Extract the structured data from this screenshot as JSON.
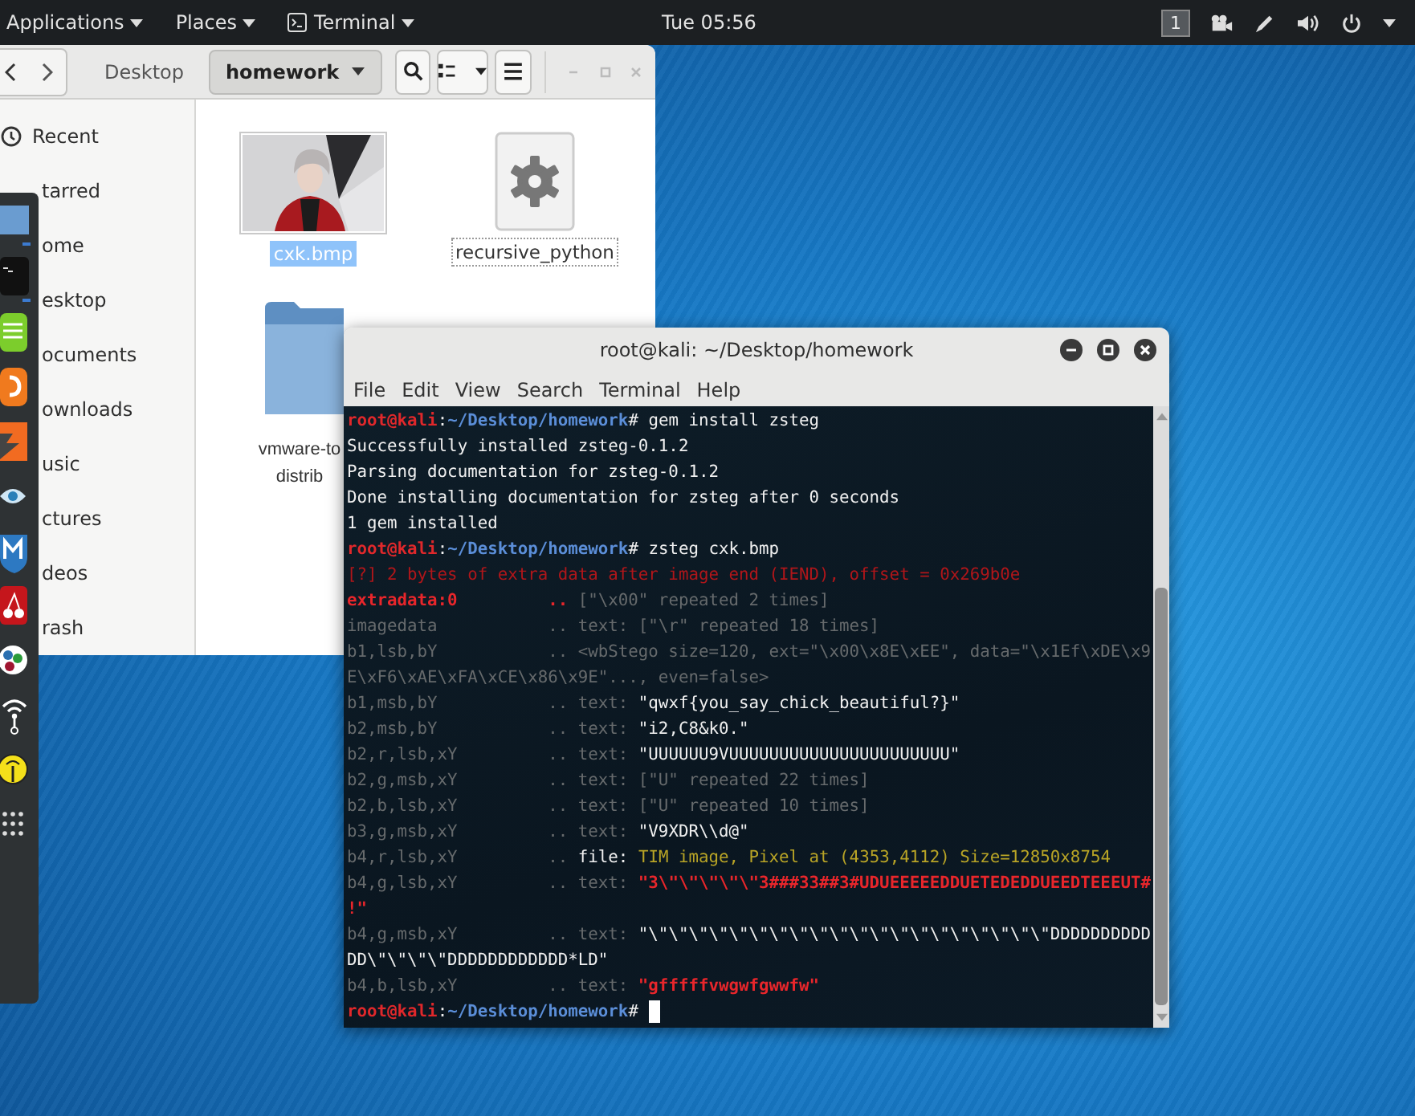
{
  "top_bar": {
    "menus": [
      {
        "label": "Applications"
      },
      {
        "label": "Places"
      },
      {
        "label": "Terminal"
      }
    ],
    "clock": "Tue 05:56",
    "workspace": "1"
  },
  "file_manager": {
    "path": [
      {
        "label": "Desktop",
        "selected": false
      },
      {
        "label": "homework",
        "selected": true
      }
    ],
    "sidebar": [
      "Recent",
      "tarred",
      "ome",
      "esktop",
      "ocuments",
      "ownloads",
      "usic",
      "ctures",
      "deos",
      "rash"
    ],
    "files": [
      {
        "label": "cxk.bmp",
        "selected": true
      },
      {
        "label": "recursive_python",
        "kind": "executable",
        "selected": false
      },
      {
        "label": "vmware-to distrib",
        "kind": "folder",
        "selected": false
      }
    ]
  },
  "terminal": {
    "title": "root@kali: ~/Desktop/homework",
    "menu": [
      "File",
      "Edit",
      "View",
      "Search",
      "Terminal",
      "Help"
    ],
    "lines": [
      {
        "segments": [
          {
            "t": "root@kali",
            "kind": "user"
          },
          {
            "t": ":",
            "kind": "plain"
          },
          {
            "t": "~/Desktop/homework",
            "kind": "path"
          },
          {
            "t": "# gem install zsteg",
            "kind": "plain"
          }
        ]
      },
      {
        "segments": [
          {
            "t": "Successfully installed zsteg-0.1.2",
            "kind": "plain"
          }
        ]
      },
      {
        "segments": [
          {
            "t": "Parsing documentation for zsteg-0.1.2",
            "kind": "plain"
          }
        ]
      },
      {
        "segments": [
          {
            "t": "Done installing documentation for zsteg after 0 seconds",
            "kind": "plain"
          }
        ]
      },
      {
        "segments": [
          {
            "t": "1 gem installed",
            "kind": "plain"
          }
        ]
      },
      {
        "segments": [
          {
            "t": "root@kali",
            "kind": "user"
          },
          {
            "t": ":",
            "kind": "plain"
          },
          {
            "t": "~/Desktop/homework",
            "kind": "path"
          },
          {
            "t": "# zsteg cxk.bmp",
            "kind": "plain"
          }
        ]
      },
      {
        "segments": [
          {
            "t": "[?] 2 bytes of extra data after image end (IEND), offset = 0x269b0e",
            "kind": "error"
          }
        ]
      },
      {
        "segments": [
          {
            "t": "extradata:0         .. ",
            "kind": "red"
          },
          {
            "t": "[\"\\x00\" repeated 2 times]",
            "kind": "dim"
          }
        ]
      },
      {
        "segments": [
          {
            "t": "imagedata           .. text: [\"\\r\" repeated 18 times]",
            "kind": "dim"
          }
        ]
      },
      {
        "segments": [
          {
            "t": "b1,lsb,bY           .. <wbStego size=120, ext=\"\\x00\\x8E\\xEE\", data=\"\\x1Ef\\xDE\\x9",
            "kind": "dim"
          }
        ]
      },
      {
        "segments": [
          {
            "t": "E\\xF6\\xAE\\xFA\\xCE\\x86\\x9E\"..., even=false>",
            "kind": "dim"
          }
        ]
      },
      {
        "segments": [
          {
            "t": "b1,msb,bY           .. text: ",
            "kind": "dim"
          },
          {
            "t": "\"qwxf{you_say_chick_beautiful?}\"",
            "kind": "plain"
          }
        ]
      },
      {
        "segments": [
          {
            "t": "b2,msb,bY           .. text: ",
            "kind": "dim"
          },
          {
            "t": "\"i2,C8&k0.\"",
            "kind": "plain"
          }
        ]
      },
      {
        "segments": [
          {
            "t": "b2,r,lsb,xY         .. text: ",
            "kind": "dim"
          },
          {
            "t": "\"UUUUUU9VUUUUUUUUUUUUUUUUUUUUUU\"",
            "kind": "plain"
          }
        ]
      },
      {
        "segments": [
          {
            "t": "b2,g,msb,xY         .. text: [\"U\" repeated 22 times]",
            "kind": "dim"
          }
        ]
      },
      {
        "segments": [
          {
            "t": "b2,b,lsb,xY         .. text: [\"U\" repeated 10 times]",
            "kind": "dim"
          }
        ]
      },
      {
        "segments": [
          {
            "t": "b3,g,msb,xY         .. text: ",
            "kind": "dim"
          },
          {
            "t": "\"V9XDR\\\\d@\"",
            "kind": "plain"
          }
        ]
      },
      {
        "segments": [
          {
            "t": "b4,r,lsb,xY         .. ",
            "kind": "dim"
          },
          {
            "t": "file: ",
            "kind": "plain"
          },
          {
            "t": "TIM image, Pixel at (4353,4112) Size=12850x8754",
            "kind": "yellow"
          }
        ]
      },
      {
        "segments": [
          {
            "t": "b4,g,lsb,xY         .. text: ",
            "kind": "dim"
          },
          {
            "t": "\"3\\\"\\\"\\\"\\\"\\\"3###33##3#UDUEEEEEDDUETEDEDDUEEDTEEEUT#",
            "kind": "red"
          }
        ]
      },
      {
        "segments": [
          {
            "t": "!\"",
            "kind": "red"
          }
        ]
      },
      {
        "segments": [
          {
            "t": "b4,g,msb,xY         .. text: ",
            "kind": "dim"
          },
          {
            "t": "\"\\\"\\\"\\\"\\\"\\\"\\\"\\\"\\\"\\\"\\\"\\\"\\\"\\\"\\\"\\\"\\\"\\\"\\\"\\\"\\\"DDDDDDDDDD",
            "kind": "plain"
          }
        ]
      },
      {
        "segments": [
          {
            "t": "DD\\\"\\\"\\\"\\\"DDDDDDDDDDDD*LD\"",
            "kind": "plain"
          }
        ]
      },
      {
        "segments": [
          {
            "t": "b4,b,lsb,xY         .. text: ",
            "kind": "dim"
          },
          {
            "t": "\"gfffffvwgwfgwwfw\"",
            "kind": "red"
          }
        ]
      },
      {
        "segments": [
          {
            "t": "root@kali",
            "kind": "user"
          },
          {
            "t": ":",
            "kind": "plain"
          },
          {
            "t": "~/Desktop/homework",
            "kind": "path"
          },
          {
            "t": "# ",
            "kind": "plain"
          }
        ]
      }
    ]
  }
}
